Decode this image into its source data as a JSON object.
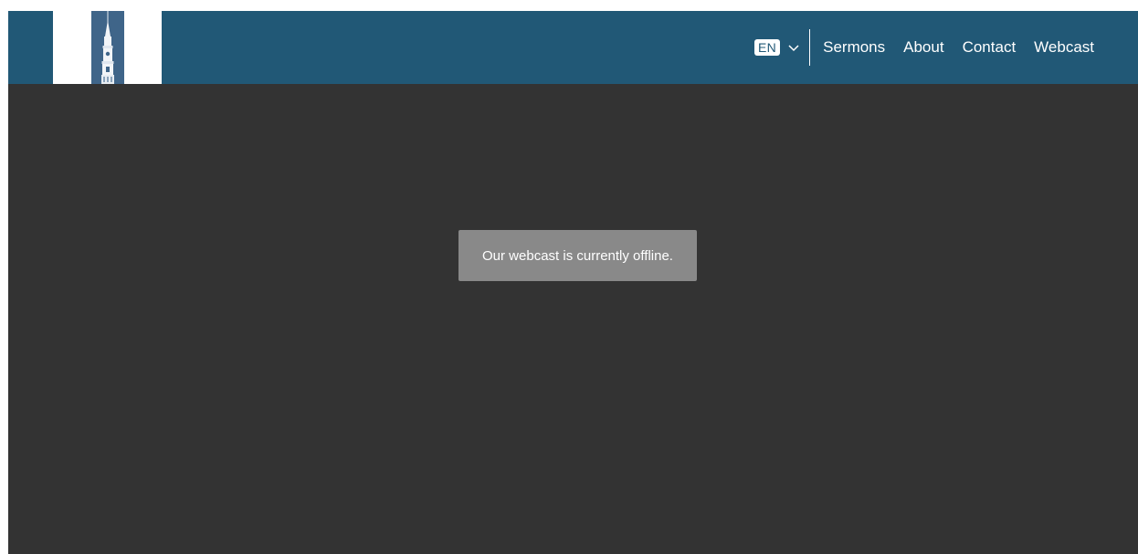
{
  "header": {
    "logo_alt": "church steeple logo",
    "language": {
      "code": "EN",
      "icon": "chevron-down-icon"
    },
    "nav": [
      {
        "label": "Sermons"
      },
      {
        "label": "About"
      },
      {
        "label": "Contact"
      },
      {
        "label": "Webcast"
      }
    ]
  },
  "main": {
    "notice": "Our webcast is currently offline."
  },
  "colors": {
    "header_bg": "#215876",
    "page_bg": "#333333",
    "notice_bg": "#898989"
  }
}
